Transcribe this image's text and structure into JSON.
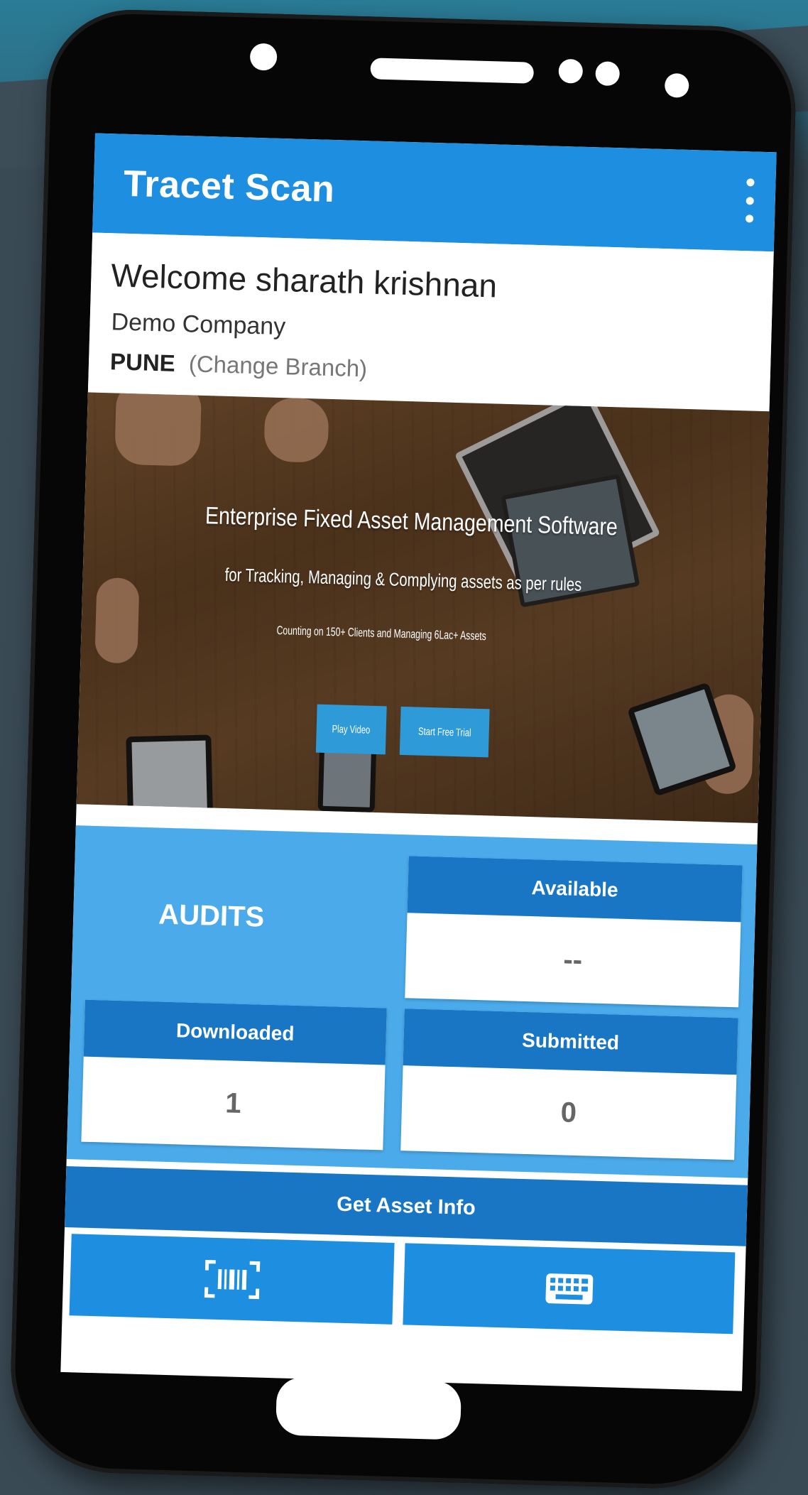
{
  "app": {
    "title": "Tracet Scan"
  },
  "welcome": {
    "greeting": "Welcome sharath krishnan",
    "company": "Demo Company",
    "branch": "PUNE",
    "change_branch": "(Change Branch)"
  },
  "banner": {
    "title": "Enterprise Fixed Asset Management Software",
    "subtitle": "for Tracking, Managing & Complying assets as per rules",
    "tagline": "Counting on 150+ Clients and Managing 6Lac+ Assets",
    "play_video": "Play Video",
    "free_trial": "Start Free Trial"
  },
  "audits": {
    "label": "AUDITS",
    "available": {
      "label": "Available",
      "value": "--"
    },
    "downloaded": {
      "label": "Downloaded",
      "value": "1"
    },
    "submitted": {
      "label": "Submitted",
      "value": "0"
    }
  },
  "asset_info": {
    "label": "Get Asset Info",
    "scan_icon": "barcode-scan-icon",
    "keyboard_icon": "keyboard-icon"
  },
  "colors": {
    "app_bar": "#1e8fe0",
    "audits_panel": "#4aaaea",
    "card_header": "#1976c4"
  }
}
